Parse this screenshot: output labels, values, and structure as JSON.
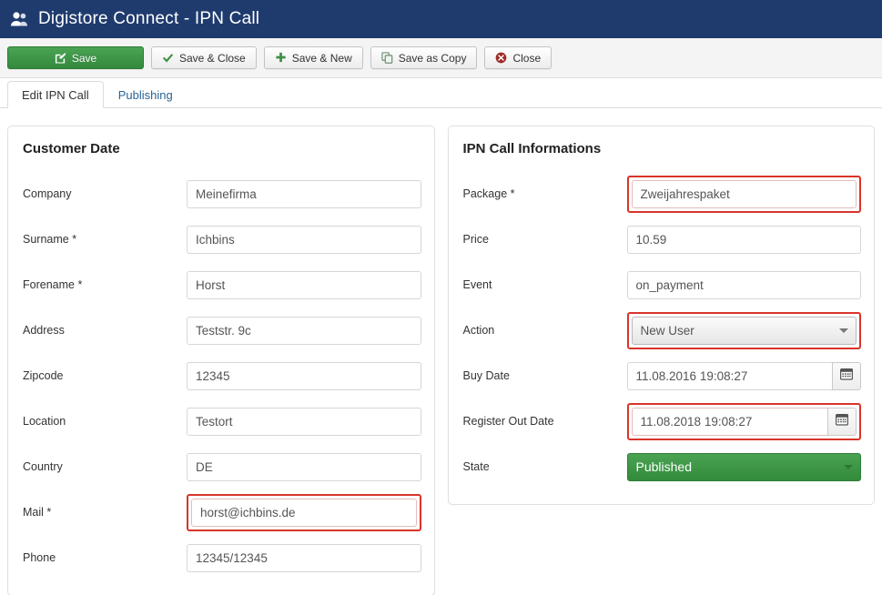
{
  "window": {
    "icon": "users-icon",
    "title": "Digistore Connect - IPN Call"
  },
  "toolbar": {
    "buttons": [
      {
        "label": "Save",
        "icon": "pencil-square-icon",
        "style": "primary"
      },
      {
        "label": "Save & Close",
        "icon": "check-icon",
        "style": "default"
      },
      {
        "label": "Save & New",
        "icon": "plus-icon",
        "style": "default"
      },
      {
        "label": "Save as Copy",
        "icon": "copy-icon",
        "style": "default"
      },
      {
        "label": "Close",
        "icon": "close-circle-icon",
        "style": "default"
      }
    ]
  },
  "tabs": [
    {
      "label": "Edit IPN Call",
      "active": true
    },
    {
      "label": "Publishing",
      "active": false
    }
  ],
  "panels": {
    "customer": {
      "title": "Customer Date",
      "fields": [
        {
          "label": "Company",
          "value": "Meinefirma",
          "type": "text",
          "flagged": false
        },
        {
          "label": "Surname *",
          "value": "Ichbins",
          "type": "text",
          "flagged": false
        },
        {
          "label": "Forename *",
          "value": "Horst",
          "type": "text",
          "flagged": false
        },
        {
          "label": "Address",
          "value": "Teststr. 9c",
          "type": "text",
          "flagged": false
        },
        {
          "label": "Zipcode",
          "value": "12345",
          "type": "text",
          "flagged": false
        },
        {
          "label": "Location",
          "value": "Testort",
          "type": "text",
          "flagged": false
        },
        {
          "label": "Country",
          "value": "DE",
          "type": "text",
          "flagged": false
        },
        {
          "label": "Mail *",
          "value": "horst@ichbins.de",
          "type": "text",
          "flagged": true
        },
        {
          "label": "Phone",
          "value": "12345/12345",
          "type": "text",
          "flagged": false
        }
      ]
    },
    "ipn": {
      "title": "IPN Call Informations",
      "fields": [
        {
          "label": "Package *",
          "value": "Zweijahrespaket",
          "type": "text",
          "flagged": true
        },
        {
          "label": "Price",
          "value": "10.59",
          "type": "text",
          "flagged": false
        },
        {
          "label": "Event",
          "value": "on_payment",
          "type": "text",
          "flagged": false
        },
        {
          "label": "Action",
          "value": "New User",
          "type": "select",
          "flagged": true
        },
        {
          "label": "Buy Date",
          "value": "11.08.2016 19:08:27",
          "type": "date",
          "flagged": false
        },
        {
          "label": "Register Out Date",
          "value": "11.08.2018 19:08:27",
          "type": "date",
          "flagged": true
        },
        {
          "label": "State",
          "value": "Published",
          "type": "select-green",
          "flagged": false
        }
      ]
    }
  },
  "colors": {
    "titlebar": "#1f3b6e",
    "primary_green": "#3f9649",
    "flag_red": "#d9342b",
    "tab_link": "#2a6496"
  }
}
